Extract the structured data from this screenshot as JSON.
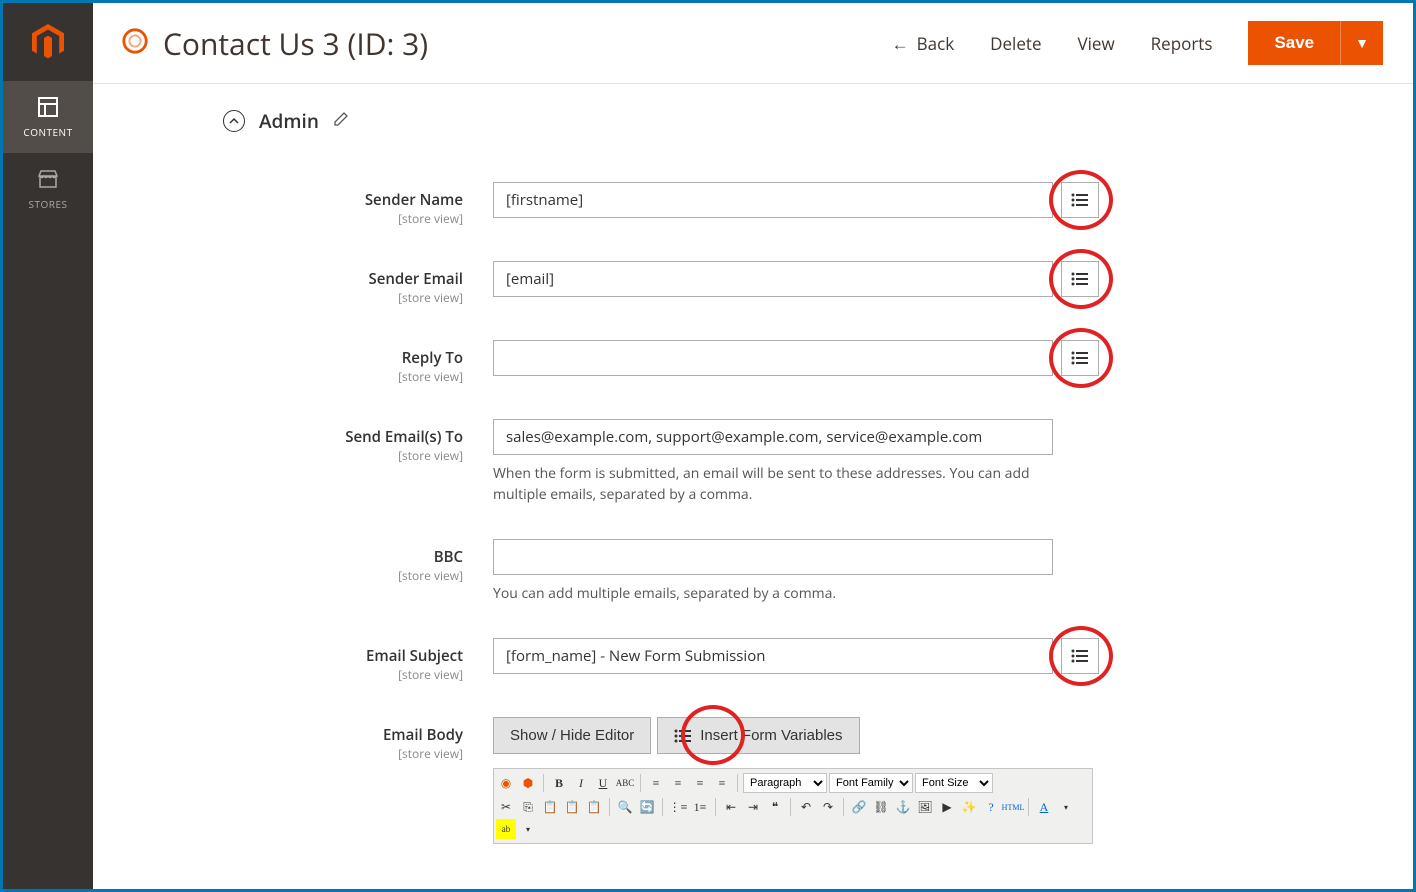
{
  "sidebar": {
    "items": [
      {
        "label": "CONTENT",
        "icon": "content"
      },
      {
        "label": "STORES",
        "icon": "stores"
      }
    ]
  },
  "header": {
    "title": "Contact Us 3 (ID: 3)",
    "back": "Back",
    "delete": "Delete",
    "view": "View",
    "reports": "Reports",
    "save": "Save"
  },
  "section": {
    "title": "Admin"
  },
  "fields": {
    "sender_name": {
      "label": "Sender Name",
      "scope": "[store view]",
      "value": "[firstname]"
    },
    "sender_email": {
      "label": "Sender Email",
      "scope": "[store view]",
      "value": "[email]"
    },
    "reply_to": {
      "label": "Reply To",
      "scope": "[store view]",
      "value": ""
    },
    "send_to": {
      "label": "Send Email(s) To",
      "scope": "[store view]",
      "value": "sales@example.com, support@example.com, service@example.com",
      "hint": "When the form is submitted, an email will be sent to these addresses. You can add multiple emails, separated by a comma."
    },
    "bcc": {
      "label": "BBC",
      "scope": "[store view]",
      "value": "",
      "hint": "You can add multiple emails, separated by a comma."
    },
    "subject": {
      "label": "Email Subject",
      "scope": "[store view]",
      "value": "[form_name] - New Form Submission"
    },
    "body": {
      "label": "Email Body",
      "scope": "[store view]"
    }
  },
  "editor": {
    "toggle": "Show / Hide Editor",
    "insert": "Insert Form Variables",
    "paragraph": "Paragraph",
    "font_family": "Font Family",
    "font_size": "Font Size"
  }
}
